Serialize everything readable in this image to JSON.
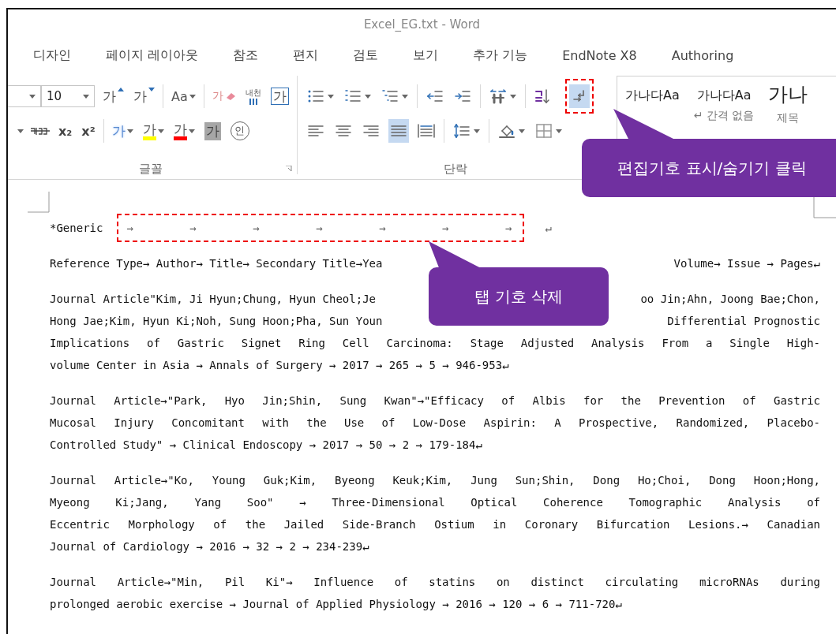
{
  "window": {
    "title": "Excel_EG.txt - Word"
  },
  "tabs": [
    {
      "label": "디자인"
    },
    {
      "label": "페이지 레이아웃"
    },
    {
      "label": "참조"
    },
    {
      "label": "편지"
    },
    {
      "label": "검토"
    },
    {
      "label": "보기"
    },
    {
      "label": "추가 기능"
    },
    {
      "label": "EndNote X8"
    },
    {
      "label": "Authoring"
    }
  ],
  "ribbon": {
    "font_size": "10",
    "font_rows": [
      [
        [
          {
            "kind": "grow",
            "glyph": "가"
          },
          {
            "kind": "shrink",
            "glyph": "가"
          }
        ],
        [
          {
            "kind": "case",
            "glyph": "Aa"
          }
        ],
        [
          {
            "kind": "clear",
            "glyph": "가"
          },
          {
            "kind": "ruby",
            "glyph": "내천"
          },
          {
            "kind": "border",
            "glyph": "가"
          }
        ]
      ],
      [
        [
          {
            "kind": "caret"
          },
          {
            "kind": "strike"
          },
          {
            "kind": "sub",
            "glyph": "x₂"
          },
          {
            "kind": "sup",
            "glyph": "x²"
          }
        ],
        [
          {
            "kind": "effects",
            "glyph": "가"
          },
          {
            "kind": "highlight",
            "glyph": "가",
            "color": "#ffff00"
          },
          {
            "kind": "fontcolor",
            "glyph": "가",
            "color": "#ff0000"
          },
          {
            "kind": "shading",
            "glyph": "가"
          },
          {
            "kind": "enclose",
            "glyph": "인"
          }
        ]
      ]
    ],
    "font_group_label": "글꼴",
    "paragraph_rows": [
      [
        [
          {
            "kind": "bullets",
            "dropdown": true,
            "selected": false
          },
          {
            "kind": "numbering",
            "dropdown": true,
            "selected": false
          },
          {
            "kind": "multilevel",
            "dropdown": true,
            "selected": false
          }
        ],
        [
          {
            "kind": "decrease-indent",
            "dropdown": false,
            "selected": false
          },
          {
            "kind": "increase-indent",
            "dropdown": false,
            "selected": false
          }
        ],
        [
          {
            "kind": "text-direction",
            "dropdown": true,
            "selected": false
          }
        ],
        [
          {
            "kind": "sort",
            "dropdown": false,
            "selected": false
          },
          {
            "kind": "show-marks",
            "dropdown": false,
            "selected": true
          }
        ]
      ],
      [
        [
          {
            "kind": "align-left",
            "dropdown": false,
            "selected": false
          },
          {
            "kind": "center",
            "dropdown": false,
            "selected": false
          },
          {
            "kind": "align-right",
            "dropdown": false,
            "selected": false
          },
          {
            "kind": "justify",
            "dropdown": false,
            "selected": true
          },
          {
            "kind": "distributed",
            "dropdown": false,
            "selected": false
          }
        ],
        [
          {
            "kind": "line-spacing",
            "dropdown": true,
            "selected": false
          }
        ],
        [
          {
            "kind": "shading",
            "dropdown": true,
            "selected": false
          },
          {
            "kind": "borders",
            "dropdown": true,
            "selected": false
          }
        ]
      ]
    ],
    "paragraph_group_label": "단락",
    "styles": [
      {
        "preview": "가나다Aa",
        "large": false
      },
      {
        "preview": "가나다Aa",
        "label": "↵ 간격 없음",
        "large": false
      },
      {
        "preview": "가나",
        "label": "제목",
        "large": true
      }
    ]
  },
  "document": {
    "tab_line": {
      "lead": "*Generic",
      "tabs": [
        "→",
        "→",
        "→",
        "→",
        "→",
        "→",
        "→"
      ],
      "end": "↵"
    },
    "paragraphs": [
      {
        "lines": [
          [
            "Reference Type→ Author→ Title→ Secondary Title→Yea",
            "Volume→ Issue → Pages↵"
          ]
        ]
      },
      {
        "lines": [
          [
            "Journal Article\"Kim, Ji Hyun;Chung, Hyun Cheol;Je",
            "oo Jin;Ahn, Joong Bae;Chon,"
          ],
          [
            "Hong Jae;Kim, Hyun Ki;Noh, Sung Hoon;Pha, Sun Youn",
            "Differential Prognostic"
          ],
          [
            "Implications of Gastric Signet Ring Cell Carcinoma: Stage Adjusted Analysis From a Single High-"
          ],
          [
            "volume Center in Asia → Annals of Surgery  →   2017 → 265 →  5  →   946-953↵"
          ]
        ]
      },
      {
        "lines": [
          [
            "Journal Article→\"Park, Hyo Jin;Shin, Sung Kwan\"→\"Efficacy of Albis for the Prevention of Gastric"
          ],
          [
            "Mucosal Injury Concomitant with the Use of Low-Dose Aspirin: A Prospective, Randomized, Placebo-"
          ],
          [
            "Controlled Study\"  →   Clinical Endoscopy  →  2017 → 50  →  2  →   179-184↵"
          ]
        ]
      },
      {
        "lines": [
          [
            "Journal Article→\"Ko, Young Guk;Kim, Byeong Keuk;Kim, Jung Sun;Shin, Dong Ho;Choi, Dong Hoon;Hong,"
          ],
          [
            "Myeong Ki;Jang, Yang Soo\"  →  Three-Dimensional Optical Coherence Tomographic Analysis of"
          ],
          [
            "Eccentric Morphology of the Jailed Side-Branch Ostium in Coronary Bifurcation Lesions.→ Canadian"
          ],
          [
            "Journal of Cardiology → 2016 → 32  →  2  →   234-239↵"
          ]
        ]
      },
      {
        "lines": [
          [
            "Journal Article→\"Min, Pil Ki\"→ Influence of statins on distinct circulating microRNAs during"
          ],
          [
            "prolonged aerobic exercise  →  Journal of Applied Physiology → 2016 →  120  →  6  →   711-720↵"
          ]
        ]
      }
    ]
  },
  "callouts": [
    {
      "text": "편집기호 표시/숨기기 클릭"
    },
    {
      "text": "탭 기호 삭제"
    }
  ]
}
